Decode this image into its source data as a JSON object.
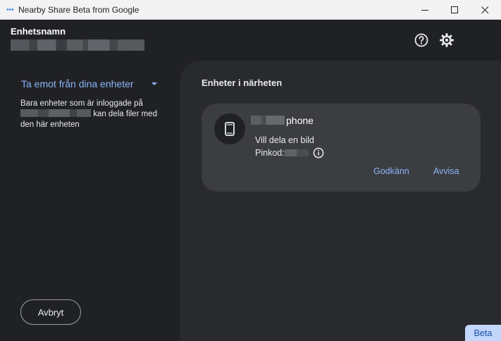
{
  "window": {
    "title": "Nearby Share Beta from Google",
    "icon": "nearby-share-icon"
  },
  "header": {
    "device_label": "Enhetsnamn",
    "icons": [
      "help-icon",
      "gear-icon"
    ]
  },
  "left": {
    "title": "Ta emot från dina enheter",
    "desc_before": "Bara enheter som är inloggade på ",
    "desc_after": " kan dela filer med den här enheten",
    "cancel_label": "Avbryt"
  },
  "right": {
    "section_title": "Enheter i närheten",
    "card": {
      "device_name_suffix": "phone",
      "description": "Vill dela en bild",
      "pin_label": "Pinkod:",
      "accept_label": "Godkänn",
      "decline_label": "Avvisa",
      "device_icon": "phone-icon"
    }
  },
  "beta_label": "Beta",
  "colors": {
    "accent": "#8ab4f8",
    "background": "#202124",
    "panel": "#292a2d",
    "card": "#3c3d41"
  }
}
